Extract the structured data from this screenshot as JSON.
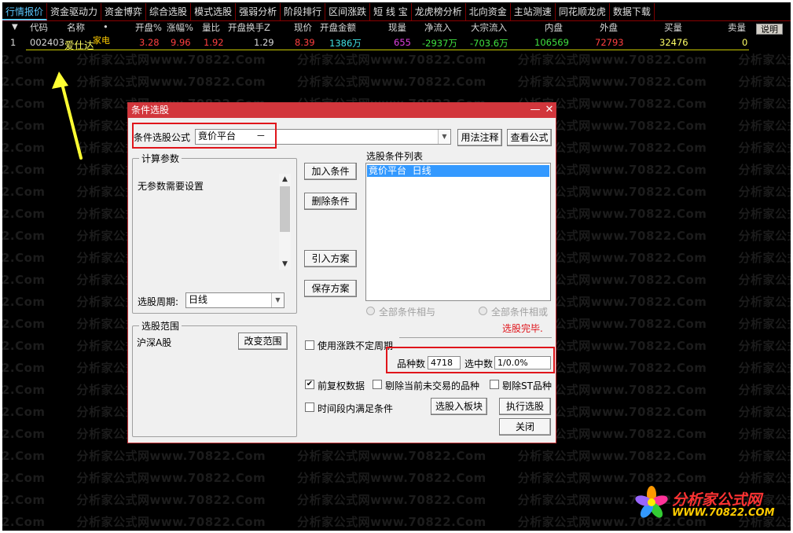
{
  "top_tabs": [
    "行情报价",
    "资金驱动力",
    "资金博弈",
    "综合选股",
    "模式选股",
    "强弱分析",
    "阶段排行",
    "区间涨跌",
    "短 线 宝",
    "龙虎榜分析",
    "北向资金",
    "主站测速",
    "同花顺龙虎",
    "数据下载"
  ],
  "table": {
    "headers": {
      "sort": "▼",
      "code": "代码",
      "name": "名称",
      "dot": "•",
      "open_pct": "开盘%",
      "chg_pct": "涨幅%",
      "vol_ratio": "量比",
      "open_turnover": "开盘换手Z",
      "price": "现价",
      "open_amount": "开盘金额",
      "cur_vol": "现量",
      "net_inflow": "净流入",
      "block_inflow": "大宗流入",
      "inner": "内盘",
      "outer": "外盘",
      "buy_vol": "买量",
      "sell_vol": "卖量"
    },
    "explain_label": "说明",
    "row": {
      "index": "1",
      "code": "002403",
      "name": "爱仕达",
      "tag": "家电",
      "open_pct": "3.28",
      "chg_pct": "9.96",
      "vol_ratio": "1.92",
      "open_turnover": "1.29",
      "price": "8.39",
      "open_amount": "1386万",
      "cur_vol": "655",
      "net_inflow": "-2937万",
      "block_inflow": "-703.6万",
      "inner": "106569",
      "outer": "72793",
      "buy_vol": "32476",
      "sell_vol": "0"
    }
  },
  "watermark": {
    "tile": "分析家公式网www.70822.Com",
    "tail": "22.Com"
  },
  "dialog": {
    "title": "条件选股",
    "formula_label": "条件选股公式",
    "formula_value": "竟价平台",
    "formula_suffix": "－",
    "usage_button": "用法注释",
    "view_button": "查看公式",
    "params_group": "计算参数",
    "params_text": "无参数需要设置",
    "period_label": "选股周期:",
    "period_value": "日线",
    "range_group": "选股范围",
    "range_text": "沪深A股",
    "change_range_button": "改变范围",
    "add_condition_button": "加入条件",
    "delete_condition_button": "删除条件",
    "import_plan_button": "引入方案",
    "save_plan_button": "保存方案",
    "condition_list_label": "选股条件列表",
    "condition_items": [
      "竟价平台  日线"
    ],
    "radio_and": "全部条件相与",
    "radio_or": "全部条件相或",
    "status_text": "选股完毕.",
    "irregular_period_label": "使用涨跌不定周期",
    "stock_count_label": "品种数",
    "stock_count_value": "4718",
    "selected_count_label": "选中数",
    "selected_count_value": "1/0.0%",
    "pre_adjust_label": "前复权数据",
    "exclude_untraded_label": "剔除当前未交易的品种",
    "exclude_st_label": "剔除ST品种",
    "period_satisfy_label": "时间段内满足条件",
    "to_block_button": "选股入板块",
    "execute_button": "执行选股",
    "close_button": "关闭"
  },
  "logo": {
    "text": "分析家公式网",
    "url": "WWW.70822.COM"
  },
  "colors": {
    "background": "#000000",
    "header_text": "#d8d8d8",
    "tab_active": "#5cc8ff",
    "up_red": "#ff4040",
    "cyan": "#40e0e0",
    "magenta": "#e040e0",
    "green": "#40e040",
    "dialog_title": "#d2363c",
    "highlight_box": "#e0151b",
    "selection": "#3399ff",
    "arrow": "#ffff33"
  }
}
